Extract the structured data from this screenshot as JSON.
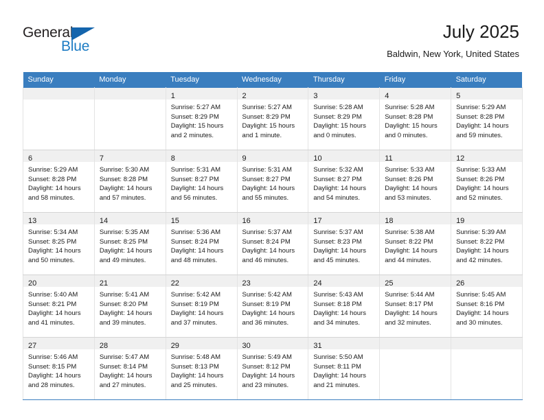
{
  "brand": {
    "name_part1": "General",
    "name_part2": "Blue",
    "flag_color": "#1465ad",
    "blue_text_color": "#1d7cc4"
  },
  "header": {
    "title": "July 2025",
    "subtitle": "Baldwin, New York, United States",
    "accent_color": "#3a7ebf"
  },
  "weekdays": [
    "Sunday",
    "Monday",
    "Tuesday",
    "Wednesday",
    "Thursday",
    "Friday",
    "Saturday"
  ],
  "weeks": [
    [
      {
        "day": "",
        "lines": []
      },
      {
        "day": "",
        "lines": []
      },
      {
        "day": "1",
        "lines": [
          "Sunrise: 5:27 AM",
          "Sunset: 8:29 PM",
          "Daylight: 15 hours",
          "and 2 minutes."
        ]
      },
      {
        "day": "2",
        "lines": [
          "Sunrise: 5:27 AM",
          "Sunset: 8:29 PM",
          "Daylight: 15 hours",
          "and 1 minute."
        ]
      },
      {
        "day": "3",
        "lines": [
          "Sunrise: 5:28 AM",
          "Sunset: 8:29 PM",
          "Daylight: 15 hours",
          "and 0 minutes."
        ]
      },
      {
        "day": "4",
        "lines": [
          "Sunrise: 5:28 AM",
          "Sunset: 8:28 PM",
          "Daylight: 15 hours",
          "and 0 minutes."
        ]
      },
      {
        "day": "5",
        "lines": [
          "Sunrise: 5:29 AM",
          "Sunset: 8:28 PM",
          "Daylight: 14 hours",
          "and 59 minutes."
        ]
      }
    ],
    [
      {
        "day": "6",
        "lines": [
          "Sunrise: 5:29 AM",
          "Sunset: 8:28 PM",
          "Daylight: 14 hours",
          "and 58 minutes."
        ]
      },
      {
        "day": "7",
        "lines": [
          "Sunrise: 5:30 AM",
          "Sunset: 8:28 PM",
          "Daylight: 14 hours",
          "and 57 minutes."
        ]
      },
      {
        "day": "8",
        "lines": [
          "Sunrise: 5:31 AM",
          "Sunset: 8:27 PM",
          "Daylight: 14 hours",
          "and 56 minutes."
        ]
      },
      {
        "day": "9",
        "lines": [
          "Sunrise: 5:31 AM",
          "Sunset: 8:27 PM",
          "Daylight: 14 hours",
          "and 55 minutes."
        ]
      },
      {
        "day": "10",
        "lines": [
          "Sunrise: 5:32 AM",
          "Sunset: 8:27 PM",
          "Daylight: 14 hours",
          "and 54 minutes."
        ]
      },
      {
        "day": "11",
        "lines": [
          "Sunrise: 5:33 AM",
          "Sunset: 8:26 PM",
          "Daylight: 14 hours",
          "and 53 minutes."
        ]
      },
      {
        "day": "12",
        "lines": [
          "Sunrise: 5:33 AM",
          "Sunset: 8:26 PM",
          "Daylight: 14 hours",
          "and 52 minutes."
        ]
      }
    ],
    [
      {
        "day": "13",
        "lines": [
          "Sunrise: 5:34 AM",
          "Sunset: 8:25 PM",
          "Daylight: 14 hours",
          "and 50 minutes."
        ]
      },
      {
        "day": "14",
        "lines": [
          "Sunrise: 5:35 AM",
          "Sunset: 8:25 PM",
          "Daylight: 14 hours",
          "and 49 minutes."
        ]
      },
      {
        "day": "15",
        "lines": [
          "Sunrise: 5:36 AM",
          "Sunset: 8:24 PM",
          "Daylight: 14 hours",
          "and 48 minutes."
        ]
      },
      {
        "day": "16",
        "lines": [
          "Sunrise: 5:37 AM",
          "Sunset: 8:24 PM",
          "Daylight: 14 hours",
          "and 46 minutes."
        ]
      },
      {
        "day": "17",
        "lines": [
          "Sunrise: 5:37 AM",
          "Sunset: 8:23 PM",
          "Daylight: 14 hours",
          "and 45 minutes."
        ]
      },
      {
        "day": "18",
        "lines": [
          "Sunrise: 5:38 AM",
          "Sunset: 8:22 PM",
          "Daylight: 14 hours",
          "and 44 minutes."
        ]
      },
      {
        "day": "19",
        "lines": [
          "Sunrise: 5:39 AM",
          "Sunset: 8:22 PM",
          "Daylight: 14 hours",
          "and 42 minutes."
        ]
      }
    ],
    [
      {
        "day": "20",
        "lines": [
          "Sunrise: 5:40 AM",
          "Sunset: 8:21 PM",
          "Daylight: 14 hours",
          "and 41 minutes."
        ]
      },
      {
        "day": "21",
        "lines": [
          "Sunrise: 5:41 AM",
          "Sunset: 8:20 PM",
          "Daylight: 14 hours",
          "and 39 minutes."
        ]
      },
      {
        "day": "22",
        "lines": [
          "Sunrise: 5:42 AM",
          "Sunset: 8:19 PM",
          "Daylight: 14 hours",
          "and 37 minutes."
        ]
      },
      {
        "day": "23",
        "lines": [
          "Sunrise: 5:42 AM",
          "Sunset: 8:19 PM",
          "Daylight: 14 hours",
          "and 36 minutes."
        ]
      },
      {
        "day": "24",
        "lines": [
          "Sunrise: 5:43 AM",
          "Sunset: 8:18 PM",
          "Daylight: 14 hours",
          "and 34 minutes."
        ]
      },
      {
        "day": "25",
        "lines": [
          "Sunrise: 5:44 AM",
          "Sunset: 8:17 PM",
          "Daylight: 14 hours",
          "and 32 minutes."
        ]
      },
      {
        "day": "26",
        "lines": [
          "Sunrise: 5:45 AM",
          "Sunset: 8:16 PM",
          "Daylight: 14 hours",
          "and 30 minutes."
        ]
      }
    ],
    [
      {
        "day": "27",
        "lines": [
          "Sunrise: 5:46 AM",
          "Sunset: 8:15 PM",
          "Daylight: 14 hours",
          "and 28 minutes."
        ]
      },
      {
        "day": "28",
        "lines": [
          "Sunrise: 5:47 AM",
          "Sunset: 8:14 PM",
          "Daylight: 14 hours",
          "and 27 minutes."
        ]
      },
      {
        "day": "29",
        "lines": [
          "Sunrise: 5:48 AM",
          "Sunset: 8:13 PM",
          "Daylight: 14 hours",
          "and 25 minutes."
        ]
      },
      {
        "day": "30",
        "lines": [
          "Sunrise: 5:49 AM",
          "Sunset: 8:12 PM",
          "Daylight: 14 hours",
          "and 23 minutes."
        ]
      },
      {
        "day": "31",
        "lines": [
          "Sunrise: 5:50 AM",
          "Sunset: 8:11 PM",
          "Daylight: 14 hours",
          "and 21 minutes."
        ]
      },
      {
        "day": "",
        "lines": []
      },
      {
        "day": "",
        "lines": []
      }
    ]
  ]
}
